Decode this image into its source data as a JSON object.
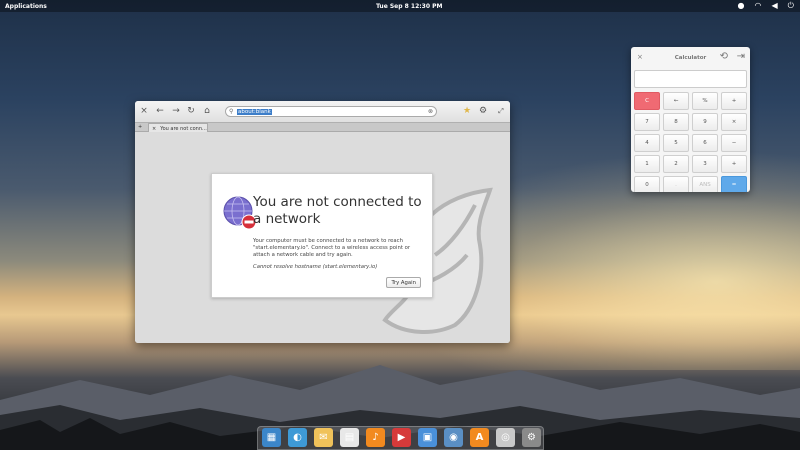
{
  "panel": {
    "applications_label": "Applications",
    "clock": "Tue Sep 8    12:30 PM"
  },
  "browser": {
    "url": "about:blank",
    "tab_title": "You are not conn..."
  },
  "error_page": {
    "heading": "You are not connected to a network",
    "body": "Your computer must be connected to a network to reach \"start.elementary.io\". Connect to a wireless access point or attach a network cable and try again.",
    "detail": "Cannot resolve hostname (start.elementary.io)",
    "button_label": "Try Again"
  },
  "calculator": {
    "title": "Calculator",
    "display": "",
    "keys": [
      "C",
      "←",
      "%",
      "+",
      "7",
      "8",
      "9",
      "×",
      "4",
      "5",
      "6",
      "−",
      "1",
      "2",
      "3",
      "+",
      "0",
      ".",
      "ANS",
      "="
    ]
  },
  "dock": {
    "apps": [
      {
        "icon": "multitasking-view-icon",
        "color": "#3b86c9"
      },
      {
        "icon": "midori-browser-icon",
        "color": "#3e9ad6"
      },
      {
        "icon": "mail-icon",
        "color": "#f0c25a"
      },
      {
        "icon": "calendar-icon",
        "color": "#e8e8e8"
      },
      {
        "icon": "music-icon",
        "color": "#f28a1f"
      },
      {
        "icon": "videos-icon",
        "color": "#d63a3a"
      },
      {
        "icon": "photos-icon",
        "color": "#4a90d9"
      },
      {
        "icon": "switchboard-icon",
        "color": "#5a8fc4"
      },
      {
        "icon": "app-center-icon",
        "color": "#f28a1f"
      },
      {
        "icon": "disc-icon",
        "color": "#c9c9c9"
      },
      {
        "icon": "settings-icon",
        "color": "#8a8a8a"
      }
    ]
  }
}
